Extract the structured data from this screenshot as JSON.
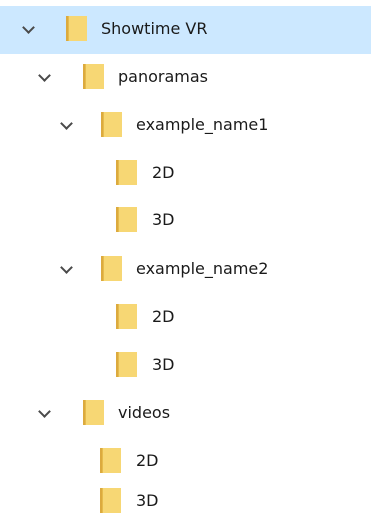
{
  "tree": {
    "root": {
      "label": "Showtime VR",
      "expanded": true,
      "selected": true,
      "icon": "folder-icon"
    },
    "panoramas": {
      "label": "panoramas",
      "expanded": true,
      "icon": "folder-icon"
    },
    "example_name1": {
      "label": "example_name1",
      "expanded": true,
      "icon": "folder-icon"
    },
    "example_name1_2d": {
      "label": "2D",
      "icon": "folder-icon"
    },
    "example_name1_3d": {
      "label": "3D",
      "icon": "folder-icon"
    },
    "example_name2": {
      "label": "example_name2",
      "expanded": true,
      "icon": "folder-icon"
    },
    "example_name2_2d": {
      "label": "2D",
      "icon": "folder-icon"
    },
    "example_name2_3d": {
      "label": "3D",
      "icon": "folder-icon"
    },
    "videos": {
      "label": "videos",
      "expanded": true,
      "icon": "folder-icon"
    },
    "videos_2d": {
      "label": "2D",
      "icon": "folder-icon"
    },
    "videos_3d": {
      "label": "3D",
      "icon": "folder-icon"
    }
  },
  "colors": {
    "selection": "#cce8ff",
    "folder_front": "#f7d774",
    "folder_back": "#dcaa3e",
    "chevron": "#4a4a4a",
    "text": "#1a1a1a"
  }
}
